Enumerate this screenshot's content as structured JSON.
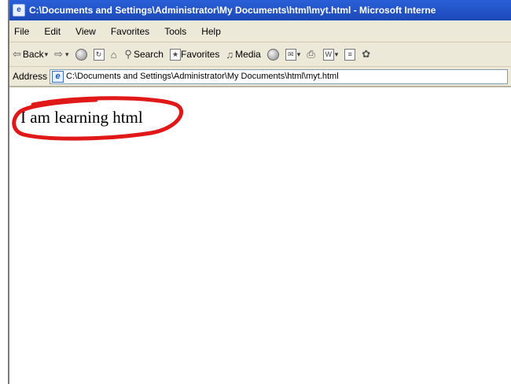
{
  "window": {
    "title": "C:\\Documents and Settings\\Administrator\\My Documents\\html\\myt.html - Microsoft Interne"
  },
  "menubar": {
    "items": [
      "File",
      "Edit",
      "View",
      "Favorites",
      "Tools",
      "Help"
    ]
  },
  "toolbar": {
    "back_label": "Back",
    "search_label": "Search",
    "favorites_label": "Favorites",
    "media_label": "Media"
  },
  "address": {
    "label": "Address",
    "value": "C:\\Documents and Settings\\Administrator\\My Documents\\html\\myt.html"
  },
  "page": {
    "body_text": "I am learning html"
  },
  "colors": {
    "titlebar": "#1c49b8",
    "chrome": "#ece9d8",
    "highlight_circle": "#e01818"
  }
}
